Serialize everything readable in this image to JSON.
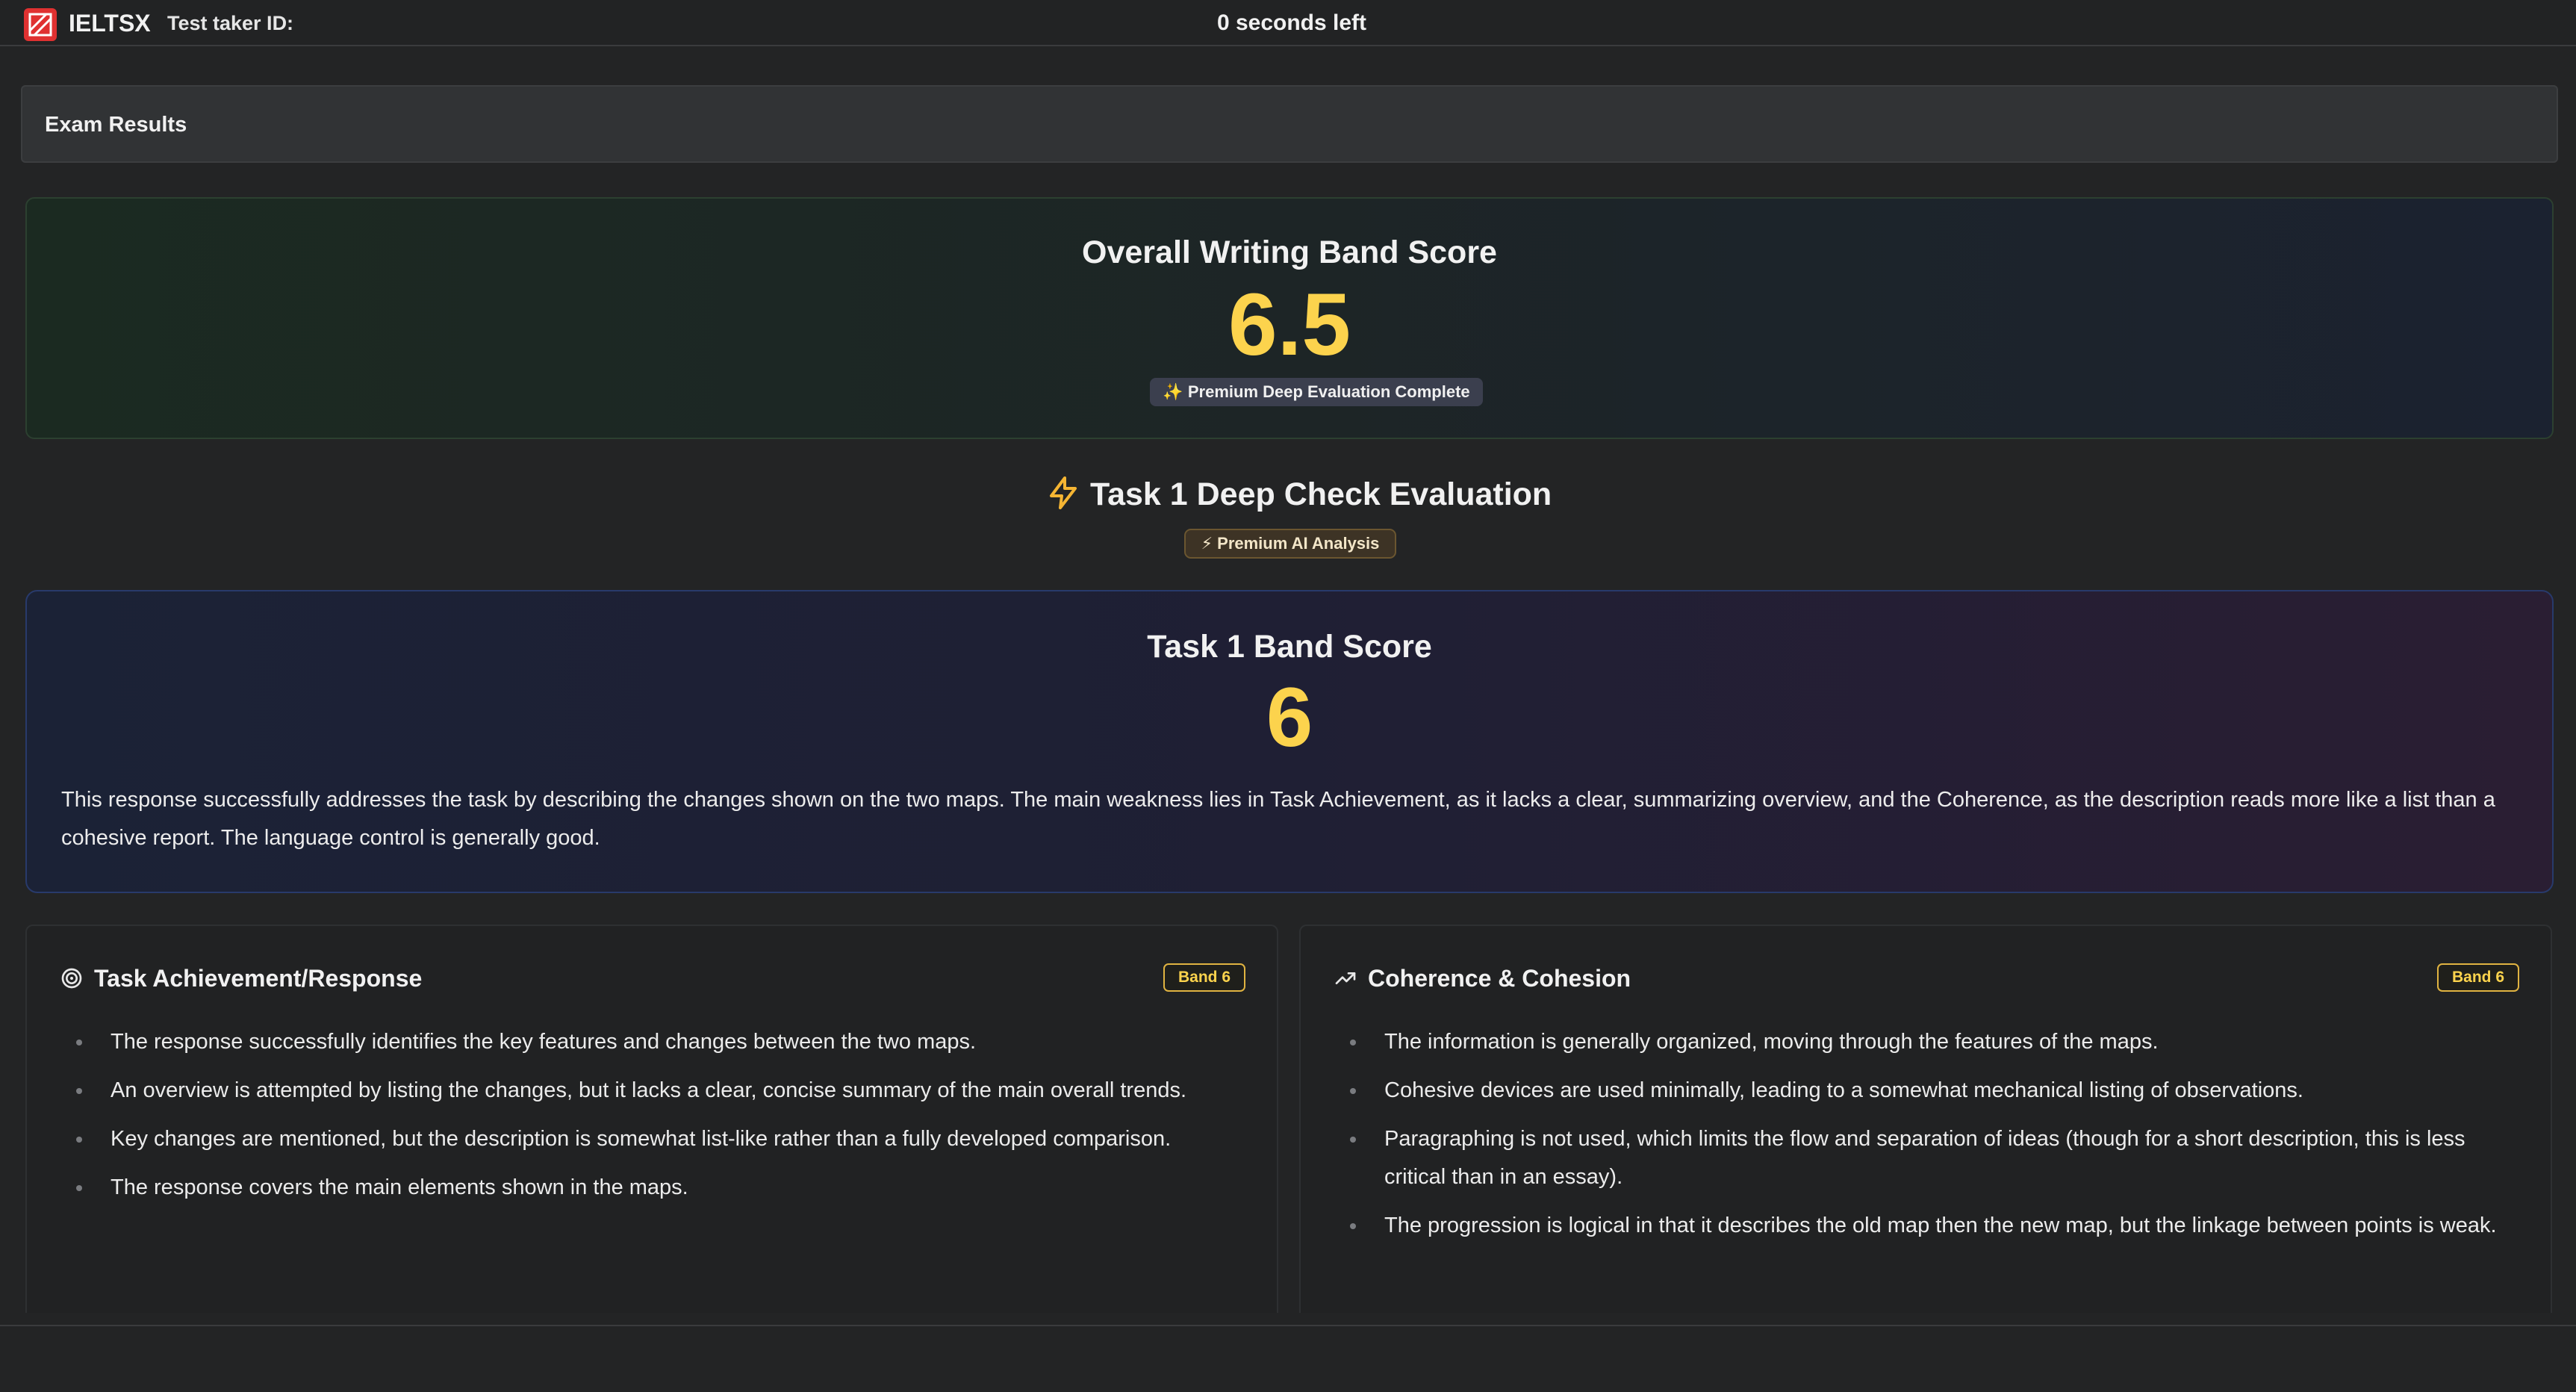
{
  "header": {
    "brand": "IELTSX",
    "test_taker_label": "Test taker ID:",
    "timer": "0 seconds left"
  },
  "results": {
    "title": "Exam Results"
  },
  "overall": {
    "title": "Overall Writing Band Score",
    "score": "6.5",
    "badge": "✨ Premium Deep Evaluation Complete"
  },
  "deep_check": {
    "title": "Task 1 Deep Check Evaluation",
    "badge": "⚡ Premium AI Analysis"
  },
  "task1": {
    "title": "Task 1 Band Score",
    "score": "6",
    "summary": "This response successfully addresses the task by describing the changes shown on the two maps. The main weakness lies in Task Achievement, as it lacks a clear, summarizing overview, and the Coherence, as the description reads more like a list than a cohesive report. The language control is generally good."
  },
  "criteria": [
    {
      "title": "Task Achievement/Response",
      "band": "Band 6",
      "icon": "target-icon",
      "points": [
        "The response successfully identifies the key features and changes between the two maps.",
        "An overview is attempted by listing the changes, but it lacks a clear, concise summary of the main overall trends.",
        "Key changes are mentioned, but the description is somewhat list-like rather than a fully developed comparison.",
        "The response covers the main elements shown in the maps."
      ]
    },
    {
      "title": "Coherence & Cohesion",
      "band": "Band 6",
      "icon": "trending-up-icon",
      "points": [
        "The information is generally organized, moving through the features of the maps.",
        "Cohesive devices are used minimally, leading to a somewhat mechanical listing of observations.",
        "Paragraphing is not used, which limits the flow and separation of ideas (though for a short description, this is less critical than in an essay).",
        "The progression is logical in that it describes the old map then the new map, but the linkage between points is weak."
      ]
    }
  ],
  "colors": {
    "background": "#232425",
    "score_yellow": "#fcd34d",
    "logo_red": "#e03131",
    "bolt_orange": "#f5b533"
  }
}
